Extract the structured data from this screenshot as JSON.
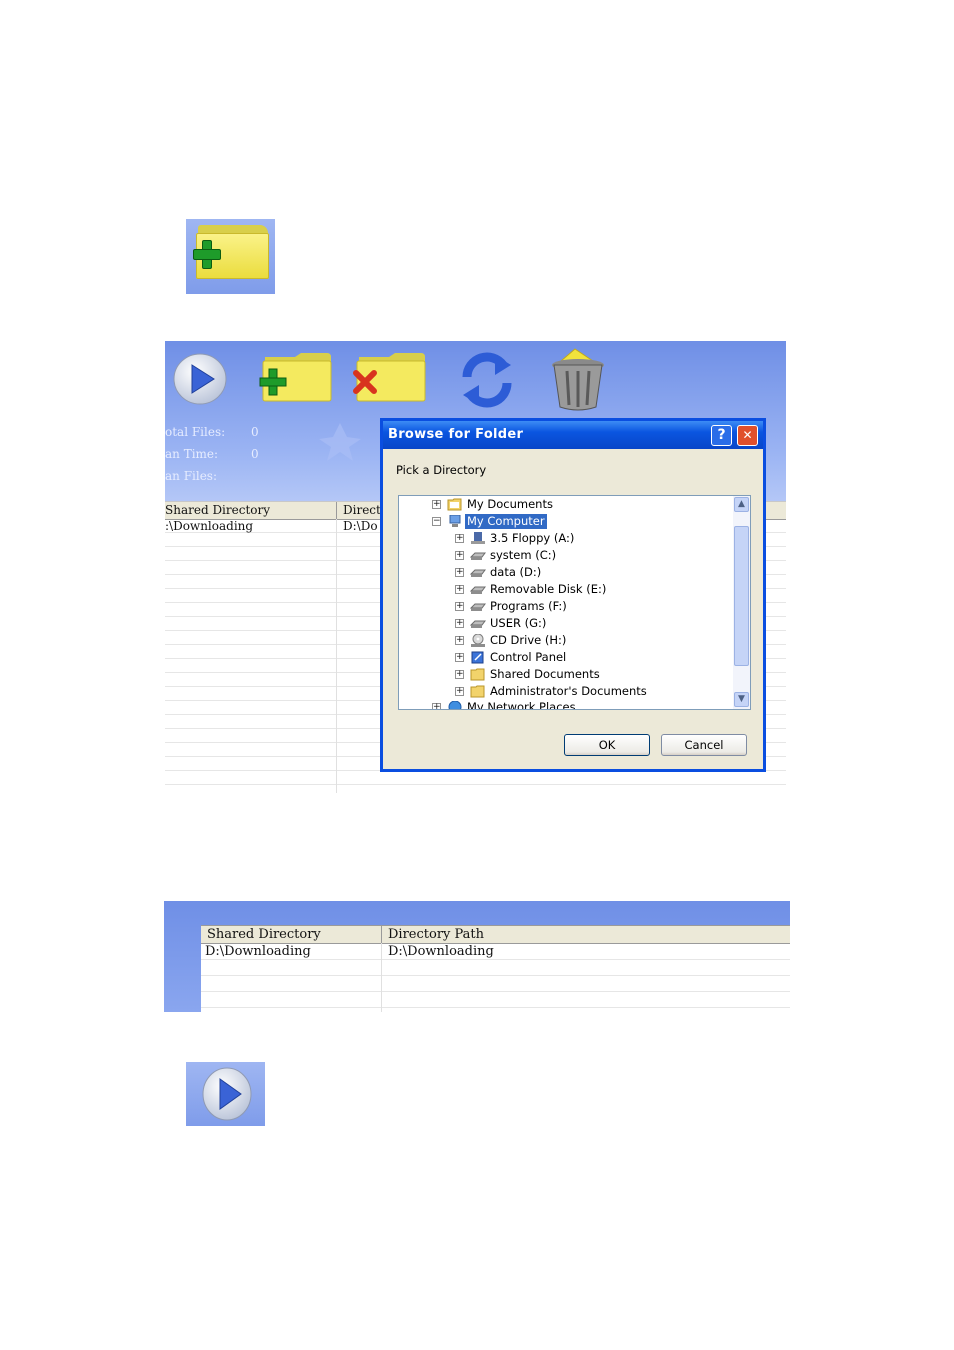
{
  "toolbar": {
    "icons": [
      "play-icon",
      "add-folder-icon",
      "remove-folder-icon",
      "refresh-icon",
      "recycle-bin-icon"
    ]
  },
  "status": {
    "total_files_label": "otal Files:",
    "total_files_value": "0",
    "scan_time_label": "an Time:",
    "scan_time_value": "0",
    "scan_files_label": "an Files:"
  },
  "grid": {
    "col1_header": "Shared Directory",
    "col2_header": "Direct",
    "rows": [
      {
        "shared_directory": ":\\Downloading",
        "directory_path": "D:\\Do"
      }
    ]
  },
  "dialog": {
    "title": "Browse for Folder",
    "help_label": "?",
    "close_label": "✕",
    "prompt": "Pick a Directory",
    "tree": [
      {
        "label": "My Documents",
        "expander": "+"
      },
      {
        "label": "My Computer",
        "expander": "−",
        "selected": true
      },
      {
        "label": "3.5 Floppy (A:)",
        "expander": "+"
      },
      {
        "label": "system (C:)",
        "expander": "+"
      },
      {
        "label": "data (D:)",
        "expander": "+"
      },
      {
        "label": "Removable Disk (E:)",
        "expander": "+"
      },
      {
        "label": "Programs (F:)",
        "expander": "+"
      },
      {
        "label": "USER (G:)",
        "expander": "+"
      },
      {
        "label": "CD Drive (H:)",
        "expander": "+"
      },
      {
        "label": "Control Panel",
        "expander": "+"
      },
      {
        "label": "Shared Documents",
        "expander": "+"
      },
      {
        "label": "Administrator's Documents",
        "expander": "+"
      },
      {
        "label": "My Network Places",
        "expander": "+"
      }
    ],
    "scroll_up": "▲",
    "scroll_down": "▼",
    "ok_label": "OK",
    "cancel_label": "Cancel"
  },
  "grid2": {
    "col1_header": "Shared Directory",
    "col2_header": "Directory Path",
    "rows": [
      {
        "shared_directory": "D:\\Downloading",
        "directory_path": "D:\\Downloading"
      }
    ]
  },
  "colors": {
    "toolbar_blue": "#7f9cea",
    "dialog_title_blue": "#0a55e0",
    "selection_blue": "#316ac5",
    "close_red": "#e0502c"
  }
}
